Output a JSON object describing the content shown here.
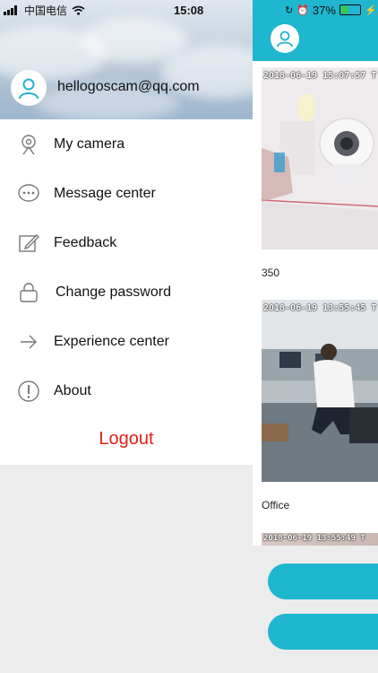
{
  "status_bar": {
    "carrier": "中国电信",
    "time": "15:08",
    "battery": "37%",
    "battery_level": 0.37
  },
  "drawer": {
    "email": "hellogoscam@qq.com",
    "menu": [
      {
        "label": "My camera",
        "icon": "camera-icon"
      },
      {
        "label": "Message center",
        "icon": "message-icon"
      },
      {
        "label": "Feedback",
        "icon": "feedback-icon"
      },
      {
        "label": "Change password",
        "icon": "lock-icon"
      },
      {
        "label": "Experience center",
        "icon": "arrow-right-icon"
      },
      {
        "label": "About",
        "icon": "info-icon"
      }
    ],
    "logout_label": "Logout"
  },
  "camera_list": {
    "items": [
      {
        "timestamp": "2018-06-19 15:07:57 T",
        "name": "350"
      },
      {
        "timestamp": "2018-06-19 13:55:45 T",
        "name": "Office"
      },
      {
        "timestamp": "2018-06-19 13:55:49 T",
        "name": ""
      }
    ]
  },
  "colors": {
    "accent": "#1fb6cf",
    "logout": "#e0201a"
  }
}
